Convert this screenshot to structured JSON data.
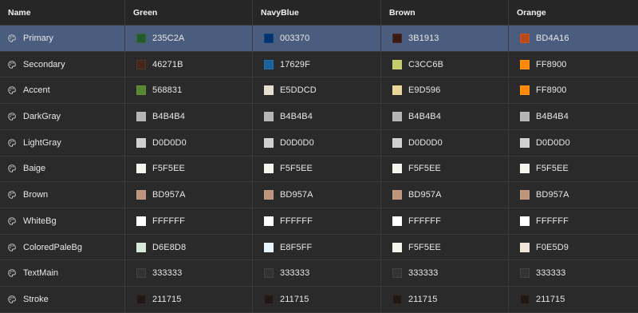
{
  "columns": [
    "Name",
    "Green",
    "NavyBlue",
    "Brown",
    "Orange"
  ],
  "icon": "palette-icon",
  "selected_row": "Primary",
  "colors": {
    "selection_bg": "#4a5d7e",
    "background": "#2a2a2a",
    "grid_line": "#3a3a3a"
  },
  "rows": [
    {
      "name": "Primary",
      "values": [
        "235C2A",
        "003370",
        "3B1913",
        "BD4A16"
      ]
    },
    {
      "name": "Secondary",
      "values": [
        "46271B",
        "17629F",
        "C3CC6B",
        "FF8900"
      ]
    },
    {
      "name": "Accent",
      "values": [
        "568831",
        "E5DDCD",
        "E9D596",
        "FF8900"
      ]
    },
    {
      "name": "DarkGray",
      "values": [
        "B4B4B4",
        "B4B4B4",
        "B4B4B4",
        "B4B4B4"
      ]
    },
    {
      "name": "LightGray",
      "values": [
        "D0D0D0",
        "D0D0D0",
        "D0D0D0",
        "D0D0D0"
      ]
    },
    {
      "name": "Baige",
      "values": [
        "F5F5EE",
        "F5F5EE",
        "F5F5EE",
        "F5F5EE"
      ]
    },
    {
      "name": "Brown",
      "values": [
        "BD957A",
        "BD957A",
        "BD957A",
        "BD957A"
      ]
    },
    {
      "name": "WhiteBg",
      "values": [
        "FFFFFF",
        "FFFFFF",
        "FFFFFF",
        "FFFFFF"
      ]
    },
    {
      "name": "ColoredPaleBg",
      "values": [
        "D6E8D8",
        "E8F5FF",
        "F5F5EE",
        "F0E5D9"
      ]
    },
    {
      "name": "TextMain",
      "values": [
        "333333",
        "333333",
        "333333",
        "333333"
      ]
    },
    {
      "name": "Stroke",
      "values": [
        "211715",
        "211715",
        "211715",
        "211715"
      ]
    }
  ]
}
